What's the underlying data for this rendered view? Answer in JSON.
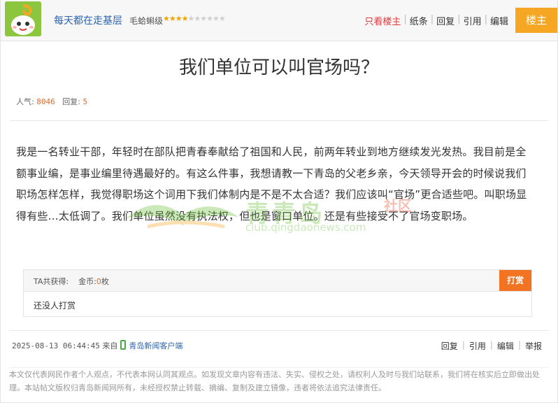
{
  "header": {
    "username": "每天都在走基层",
    "level_label": "毛蛤蝌级",
    "rating": {
      "filled": 4,
      "total": 10
    },
    "actions": [
      "只看楼主",
      "纸条",
      "回复",
      "引用",
      "编辑"
    ],
    "owner_badge": "楼主"
  },
  "post": {
    "title": "我们单位可以叫官场吗？",
    "views_label": "人气:",
    "views": "8046",
    "replies_label": "回复:",
    "replies": "5",
    "body": "我是一名转业干部，年轻时在部队把青春奉献给了祖国和人民，前两年转业到地方继续发光发热。我目前是全额事业编，是事业编里待遇最好的。有这么件事，我想请教一下青岛的父老乡亲，今天领导开会的时候说我们职场怎样怎样，我觉得职场这个词用下我们体制内是不是不太合适？我们应该叫“官场”更合适些吧。叫职场显得有些…太低调了。我们单位虽然没有执法权，但也是窗口单位。还是有些接受不了官场变职场。"
  },
  "watermark": {
    "text": "青青岛",
    "red_text": "社区",
    "url": "club.qingdaonews.com"
  },
  "reward": {
    "label": "TA共获得:",
    "coin_label": "金币:",
    "coin_value": "0",
    "coin_unit": "枚",
    "button": "打赏",
    "none_text": "还没人打赏"
  },
  "footer": {
    "timestamp": "2025-08-13 06:44:45",
    "from_label": "来自",
    "client": "青岛新闻客户端",
    "actions": [
      "回复",
      "引用",
      "编辑",
      "举报"
    ],
    "disclaimer": "本文仅代表网民作者个人观点，不代表本网认同其观点。如发现文章内容有违法、失实、侵权之处，请权利人及时与我们站联系，我们将在核实后立即做出处理。本站帖文版权归青岛新闻网所有，未经授权禁止转载、摘编、复制及建立镜像，违者将依法追究法律责任。"
  },
  "colors": {
    "accent_orange": "#f5a623",
    "link_blue": "#2a63b0",
    "number_orange": "#e46a25",
    "reward_button": "#f27321"
  }
}
